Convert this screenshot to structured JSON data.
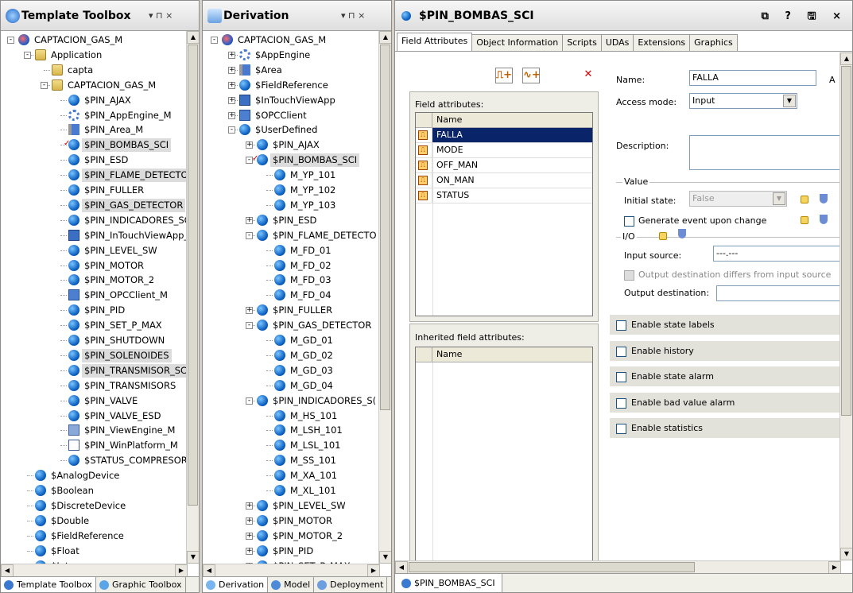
{
  "toolbox": {
    "title": "Template Toolbox",
    "controls": "▾  ⊓  ×",
    "items": [
      "CAPTACION_GAS_M",
      "Application",
      "capta",
      "CAPTACION_GAS_M",
      "$PIN_AJAX",
      "$PIN_AppEngine_M",
      "$PIN_Area_M",
      "$PIN_BOMBAS_SCI",
      "$PIN_ESD",
      "$PIN_FLAME_DETECTOR",
      "$PIN_FULLER",
      "$PIN_GAS_DETECTOR",
      "$PIN_INDICADORES_SC",
      "$PIN_InTouchViewApp_I",
      "$PIN_LEVEL_SW",
      "$PIN_MOTOR",
      "$PIN_MOTOR_2",
      "$PIN_OPCClient_M",
      "$PIN_PID",
      "$PIN_SET_P_MAX",
      "$PIN_SHUTDOWN",
      "$PIN_SOLENOIDES",
      "$PIN_TRANSMISOR_SCI",
      "$PIN_TRANSMISORS",
      "$PIN_VALVE",
      "$PIN_VALVE_ESD",
      "$PIN_ViewEngine_M",
      "$PIN_WinPlatform_M",
      "$STATUS_COMPRESOR_",
      "$AnalogDevice",
      "$Boolean",
      "$DiscreteDevice",
      "$Double",
      "$FieldReference",
      "$Float",
      "$Integer"
    ],
    "tabs": [
      "Template Toolbox",
      "Graphic Toolbox"
    ]
  },
  "derivation": {
    "title": "Derivation",
    "controls": "▾  ⊓  ×",
    "items": [
      "CAPTACION_GAS_M",
      "$AppEngine",
      "$Area",
      "$FieldReference",
      "$InTouchViewApp",
      "$OPCClient",
      "$UserDefined",
      "$PIN_AJAX",
      "$PIN_BOMBAS_SCI",
      "M_YP_101",
      "M_YP_102",
      "M_YP_103",
      "$PIN_ESD",
      "$PIN_FLAME_DETECTO",
      "M_FD_01",
      "M_FD_02",
      "M_FD_03",
      "M_FD_04",
      "$PIN_FULLER",
      "$PIN_GAS_DETECTOR",
      "M_GD_01",
      "M_GD_02",
      "M_GD_03",
      "M_GD_04",
      "$PIN_INDICADORES_S(",
      "M_HS_101",
      "M_LSH_101",
      "M_LSL_101",
      "M_SS_101",
      "M_XA_101",
      "M_XL_101",
      "$PIN_LEVEL_SW",
      "$PIN_MOTOR",
      "$PIN_MOTOR_2",
      "$PIN_PID",
      "$PIN_SET_P_MAX"
    ],
    "tabs": [
      "Derivation",
      "Model",
      "Deployment"
    ]
  },
  "editor": {
    "title": "$PIN_BOMBAS_SCI",
    "controls": "⧉ ? 🖫 ×",
    "tabs": [
      "Field Attributes",
      "Object Information",
      "Scripts",
      "UDAs",
      "Extensions",
      "Graphics"
    ],
    "toolbar": {
      "add_discrete": "⎍+",
      "add_analog": "∿+",
      "delete": "✕"
    },
    "field_attributes_label": "Field attributes:",
    "grid_header": "Name",
    "fields": [
      "FALLA",
      "MODE",
      "OFF_MAN",
      "ON_MAN",
      "STATUS"
    ],
    "inherited_label": "Inherited field attributes:",
    "inherited_header": "Name",
    "name_label": "Name:",
    "name_value": "FALLA",
    "name_extra": "A",
    "access_label": "Access mode:",
    "access_value": "Input",
    "description_label": "Description:",
    "value_group": "Value",
    "initial_state_label": "Initial state:",
    "initial_state_value": "False",
    "generate_event_label": "Generate event upon change",
    "io_group": "I/O",
    "input_source_label": "Input source:",
    "input_source_value": "---.---",
    "output_differs_label": "Output destination differs from input source",
    "output_dest_label": "Output destination:",
    "bands": [
      "Enable state labels",
      "Enable history",
      "Enable state alarm",
      "Enable bad value alarm",
      "Enable statistics"
    ],
    "doc_tab": "$PIN_BOMBAS_SCI"
  }
}
